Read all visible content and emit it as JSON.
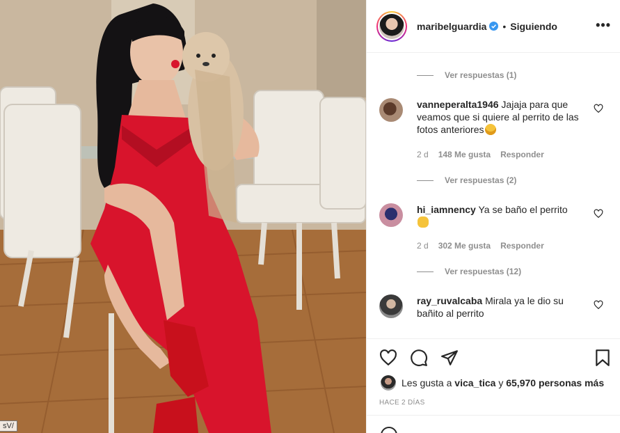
{
  "photo": {
    "corner_tag": "sV/"
  },
  "header": {
    "username": "maribelguardia",
    "dot": "•",
    "follow_status": "Siguiendo",
    "more": "•••"
  },
  "comments": {
    "replies_0": "Ver respuestas (1)",
    "items": [
      {
        "username": "vanneperalta1946",
        "text": "Jajaja para que veamos que si quiere al perrito de las fotos anteriores",
        "emoji": "grinning-sweat-emoji",
        "age": "2 d",
        "likes": "148 Me gusta",
        "reply": "Responder",
        "view_replies": "Ver respuestas (2)"
      },
      {
        "username": "hi_iamnency",
        "text": "Ya se baño el perrito",
        "emoji": "clapping-hands-emoji",
        "age": "2 d",
        "likes": "302 Me gusta",
        "reply": "Responder",
        "view_replies": "Ver respuestas (12)"
      },
      {
        "username": "ray_ruvalcaba",
        "text": "Mirala ya le dio su bañito al perrito"
      }
    ]
  },
  "actions": {
    "likes_prefix": "Les gusta a",
    "likes_user": "vica_tica",
    "likes_and": "y",
    "likes_count": "65,970 personas más",
    "timestamp": "HACE 2 DÍAS"
  },
  "icons": [
    "heart-icon",
    "comment-icon",
    "share-icon",
    "bookmark-icon",
    "verified-badge-icon",
    "more-options-icon",
    "emoji-icon"
  ],
  "colors": {
    "accent_blue": "#3897f0",
    "text": "#262626",
    "muted": "#8e8e8e",
    "dress_red": "#d8142c"
  }
}
